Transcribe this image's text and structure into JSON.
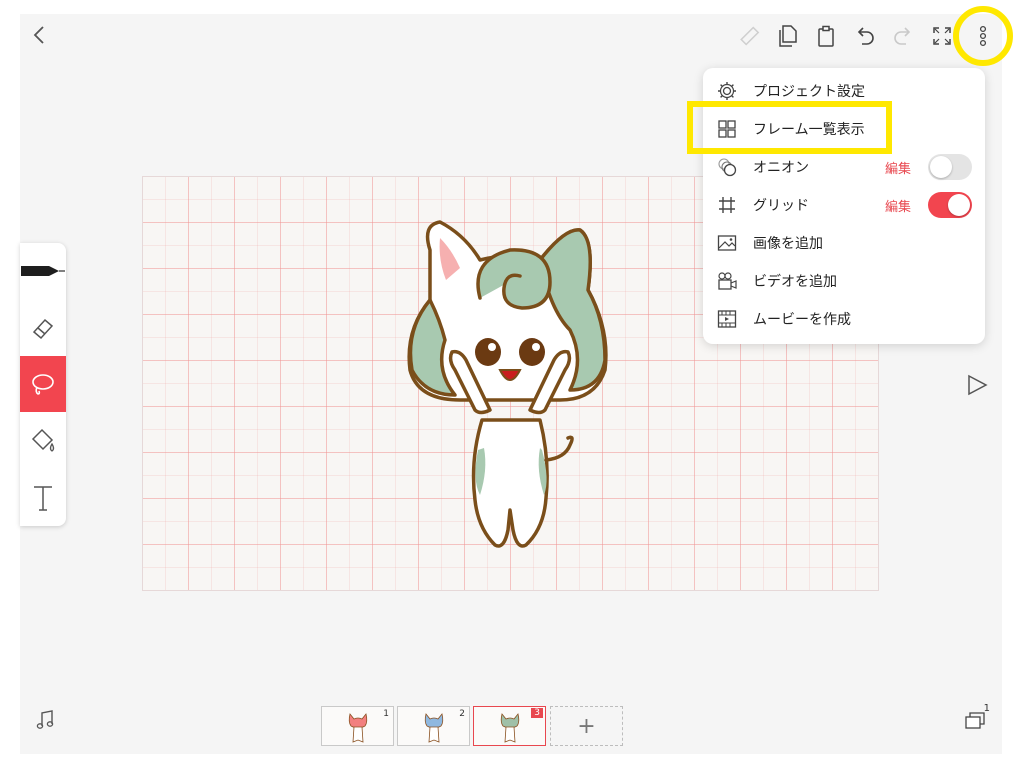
{
  "top_bar": {
    "icons": [
      "back-chevron-icon",
      "ruler-icon",
      "copy-icon",
      "paste-icon",
      "undo-icon",
      "redo-icon",
      "fullscreen-icon",
      "more-options-icon"
    ]
  },
  "menu": {
    "items": [
      {
        "label": "プロジェクト設定",
        "icon": "gear-icon"
      },
      {
        "label": "フレーム一覧表示",
        "icon": "grid-icon"
      },
      {
        "label": "オニオン",
        "icon": "onion-icon",
        "edit": "編集",
        "toggle": false
      },
      {
        "label": "グリッド",
        "icon": "hash-icon",
        "edit": "編集",
        "toggle": true
      },
      {
        "label": "画像を追加",
        "icon": "image-icon"
      },
      {
        "label": "ビデオを追加",
        "icon": "video-icon"
      },
      {
        "label": "ムービーを作成",
        "icon": "movie-icon"
      }
    ]
  },
  "tools": [
    "pen-icon",
    "eraser-icon",
    "lasso-icon",
    "fill-bucket-icon",
    "text-tool-icon"
  ],
  "active_tool": "lasso-icon",
  "frames": [
    {
      "number": "1",
      "color": "#f28080"
    },
    {
      "number": "2",
      "color": "#8fb8e0"
    },
    {
      "number": "3",
      "color": "#9fc0a8"
    }
  ],
  "active_frame": "3",
  "add_frame_label": "+",
  "layer_count": "1",
  "colors": {
    "accent": "#f2454f",
    "highlight": "#ffe800",
    "character_green": "#a8c9b0",
    "outline": "#7a4e1a"
  }
}
